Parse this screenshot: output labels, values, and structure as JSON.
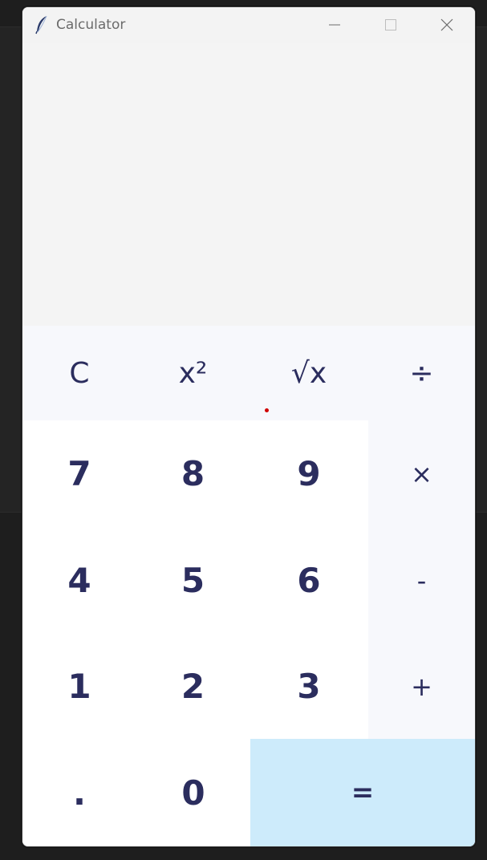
{
  "window": {
    "title": "Calculator",
    "controls": [
      "minimize",
      "maximize",
      "close"
    ]
  },
  "display": {
    "value": ""
  },
  "keys": {
    "clear": "C",
    "square": "x²",
    "sqrt": "√x",
    "divide": "÷",
    "multiply": "×",
    "subtract": "-",
    "add": "+",
    "equals": "=",
    "decimal": ".",
    "d0": "0",
    "d1": "1",
    "d2": "2",
    "d3": "3",
    "d4": "4",
    "d5": "5",
    "d6": "6",
    "d7": "7",
    "d8": "8",
    "d9": "9"
  },
  "colors": {
    "key_text": "#2b2d5e",
    "equals_bg": "#cdebfb",
    "function_bg": "#f7f8fc",
    "display_bg": "#f4f4f4"
  },
  "icons": {
    "app": "feather-icon",
    "minimize": "minimize-icon",
    "maximize": "maximize-icon",
    "close": "close-icon"
  }
}
